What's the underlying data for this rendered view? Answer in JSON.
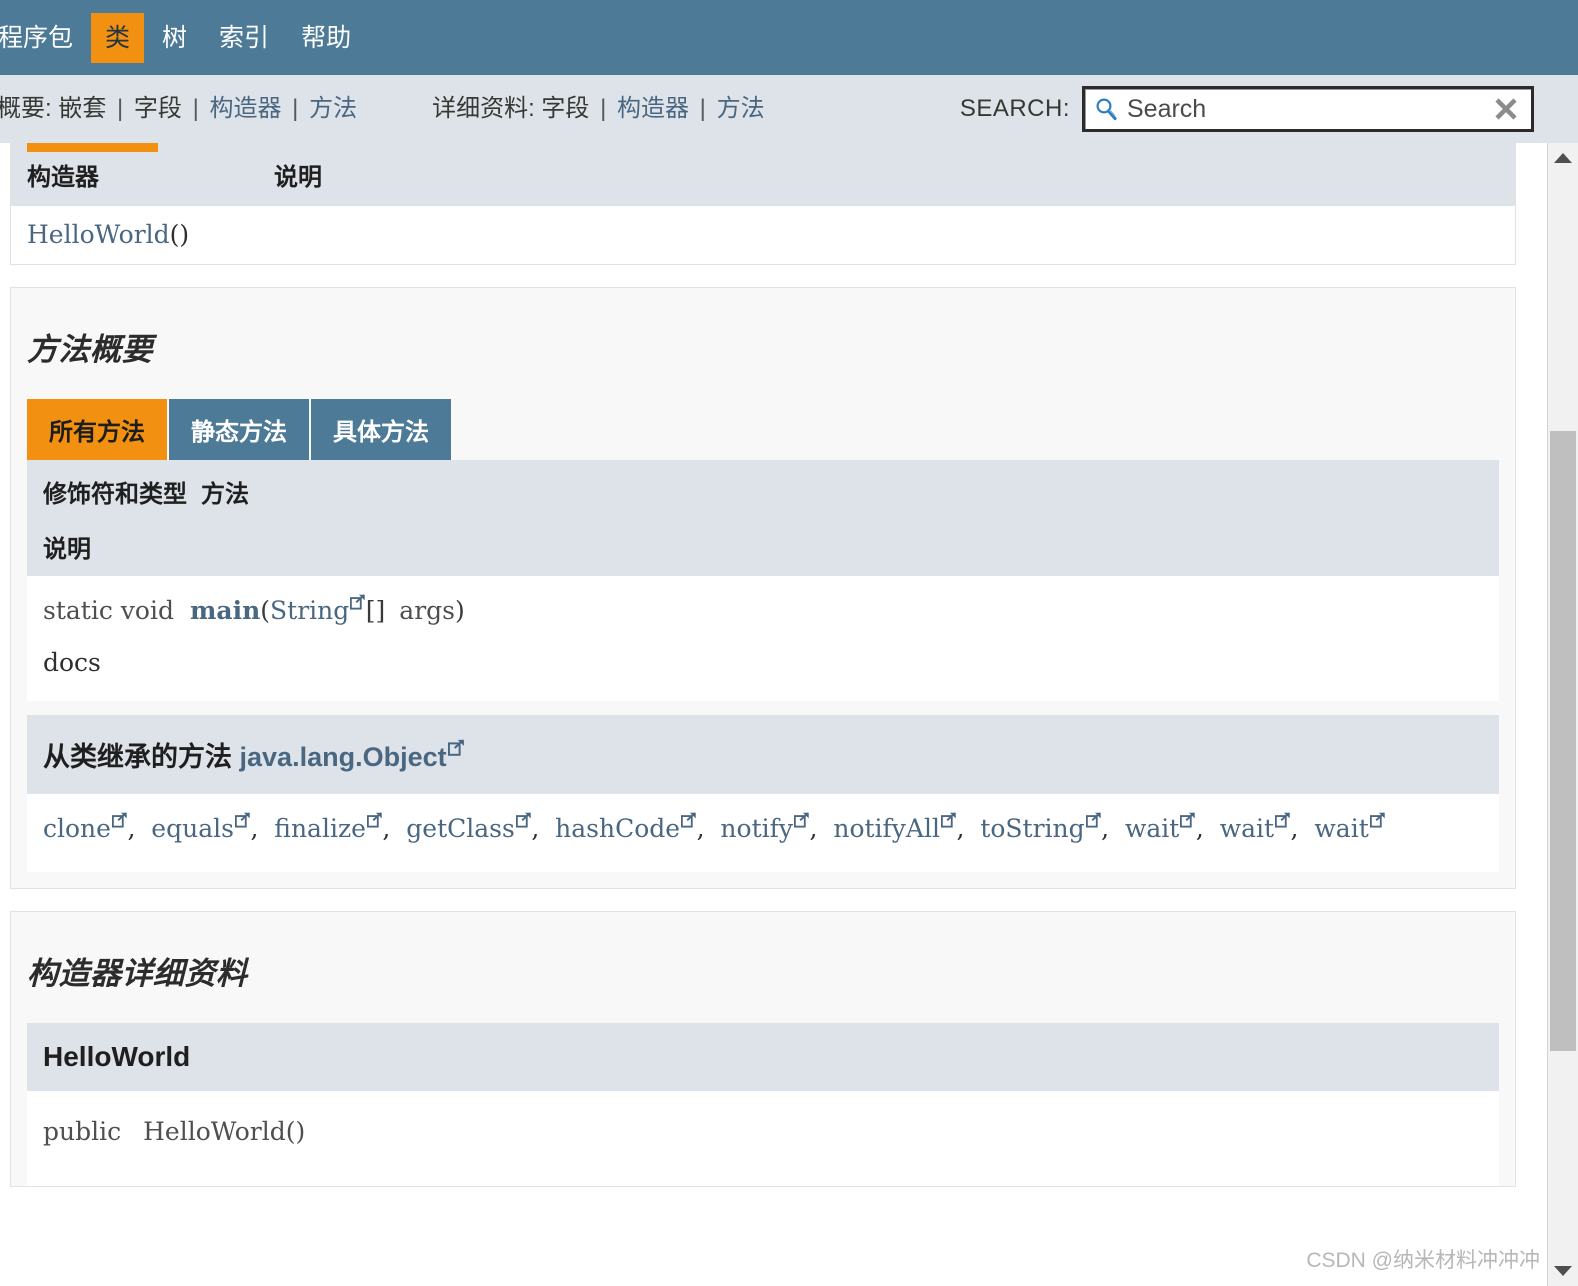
{
  "top_nav": {
    "items": [
      {
        "label": "程序包",
        "active": false
      },
      {
        "label": "类",
        "active": true
      },
      {
        "label": "树",
        "active": false
      },
      {
        "label": "索引",
        "active": false
      },
      {
        "label": "帮助",
        "active": false
      }
    ]
  },
  "sub_nav": {
    "summary_label": "概要:",
    "summary_items": [
      "嵌套",
      "字段",
      "构造器",
      "方法"
    ],
    "detail_label": "详细资料:",
    "detail_items": [
      "字段",
      "构造器",
      "方法"
    ],
    "separator": "|"
  },
  "search": {
    "label": "SEARCH:",
    "placeholder": "Search",
    "value": "",
    "icon": "search-icon",
    "reset_icon": "close-icon"
  },
  "constructor_summary": {
    "headers": [
      "构造器",
      "说明"
    ],
    "rows": [
      {
        "name": "HelloWorld",
        "signature": "()",
        "description": ""
      }
    ]
  },
  "method_summary": {
    "title": "方法概要",
    "tabs": [
      {
        "label": "所有方法",
        "active": true
      },
      {
        "label": "静态方法",
        "active": false
      },
      {
        "label": "具体方法",
        "active": false
      }
    ],
    "headers": [
      "修饰符和类型",
      "方法",
      "说明"
    ],
    "rows": [
      {
        "modifier": "static void",
        "method_name": "main",
        "param_type": "String",
        "param_suffix": "[]",
        "param_name": "args",
        "description": "docs"
      }
    ]
  },
  "inherited": {
    "prefix": "从类继承的方法",
    "class_name": "java.lang.Object",
    "methods": [
      "clone",
      "equals",
      "finalize",
      "getClass",
      "hashCode",
      "notify",
      "notifyAll",
      "toString",
      "wait",
      "wait",
      "wait"
    ]
  },
  "constructor_detail": {
    "title": "构造器详细资料",
    "member_name": "HelloWorld",
    "signature_modifier": "public",
    "signature_name": "HelloWorld()"
  },
  "scrollbar": {
    "up_icon": "chevron-up-icon",
    "down_icon": "chevron-down-icon"
  },
  "watermark": "CSDN @纳米材料冲冲冲",
  "colors": {
    "nav_bg": "#4D7A97",
    "accent_orange": "#F29111",
    "subnav_bg": "#DEE3E9",
    "link_blue": "#4A6782"
  }
}
